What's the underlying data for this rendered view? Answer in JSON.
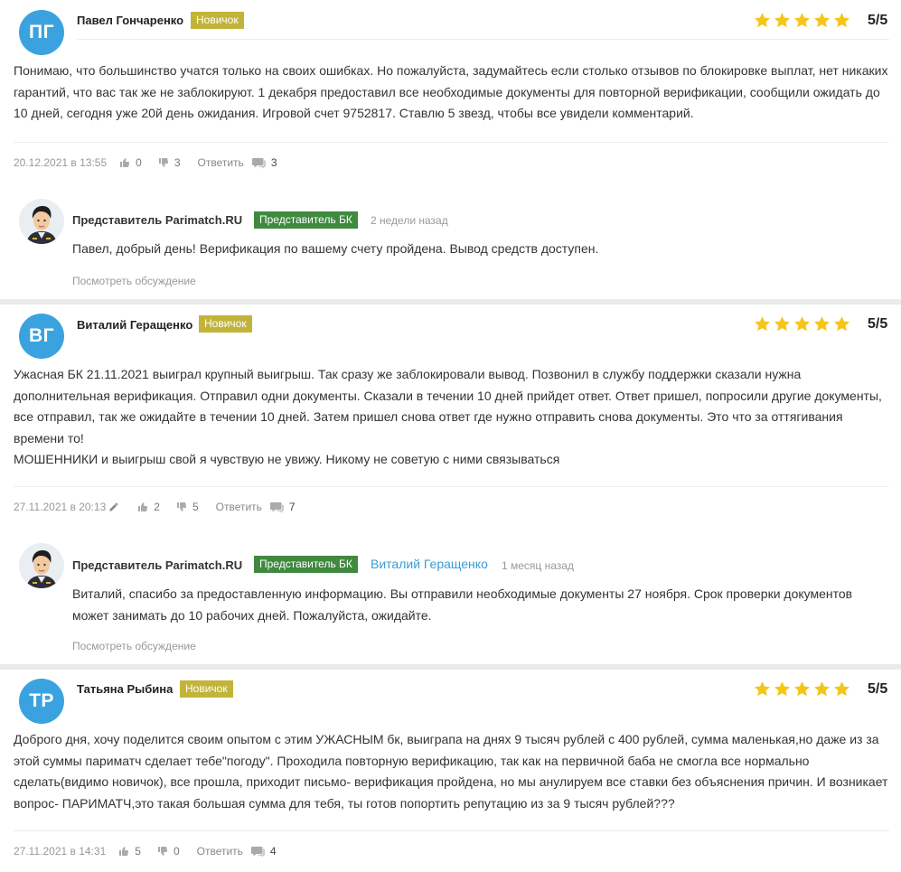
{
  "colors": {
    "avatar": "#3aa3df",
    "newbie_badge": "#c2b43b",
    "rep_badge": "#3f8a3f",
    "star": "#f5c518",
    "link": "#3a9bd6"
  },
  "reviews": [
    {
      "initials": "ПГ",
      "author": "Павел Гончаренко",
      "badge": "Новичок",
      "rating_text": "5/5",
      "rating": 5,
      "text": "Понимаю, что большинство учатся только на своих ошибках. Но пожалуйста, задумайтесь если столько отзывов по блокировке выплат, нет никаких гарантий, что вас так же не заблокируют. 1 декабря предоставил все необходимые документы для повторной верификации, сообщили ожидать до 10 дней, сегодня уже 20й день ожидания. Игровой счет 9752817. Ставлю 5 звезд, чтобы все увидели комментарий.",
      "date": "20.12.2021 в 13:55",
      "likes": "0",
      "dislikes": "3",
      "reply_label": "Ответить",
      "comments": "3",
      "response": {
        "name": "Представитель Parimatch.RU",
        "badge": "Представитель БК",
        "to": "",
        "time": "2 недели назад",
        "text": "Павел, добрый день! Верификация по вашему счету пройдена. Вывод средств доступен.",
        "link": "Посмотреть обсуждение"
      }
    },
    {
      "initials": "ВГ",
      "author": "Виталий Геращенко",
      "badge": "Новичок",
      "rating_text": "5/5",
      "rating": 5,
      "text": "Ужасная БК 21.11.2021 выиграл крупный выигрыш. Так сразу же заблокировали вывод. Позвонил в службу поддержки сказали нужна дополнительная верификация. Отправил одни документы. Сказали в течении 10 дней прийдет ответ. Ответ пришел, попросили другие документы, все отправил, так же ожидайте в течении 10 дней. Затем пришел снова ответ где нужно отправить снова документы. Это что за оттягивания времени то!\nМОШЕННИКИ и выигрыш свой я чувствую не увижу. Никому не советую с ними связываться",
      "date": "27.11.2021 в 20:13",
      "likes": "2",
      "dislikes": "5",
      "reply_label": "Ответить",
      "comments": "7",
      "response": {
        "name": "Представитель Parimatch.RU",
        "badge": "Представитель БК",
        "to": "Виталий Геращенко",
        "time": "1 месяц назад",
        "text": "Виталий, спасибо за предоставленную информацию. Вы отправили необходимые документы 27 ноября. Срок проверки документов может занимать до 10 рабочих дней. Пожалуйста, ожидайте.",
        "link": "Посмотреть обсуждение"
      }
    },
    {
      "initials": "ТР",
      "author": "Татьяна Рыбина",
      "badge": "Новичок",
      "rating_text": "5/5",
      "rating": 5,
      "text": "Доброго дня, хочу поделится своим опытом с этим УЖАСНЫМ бк, выиграпа на днях 9 тысяч рублей с 400 рублей, сумма маленькая,но даже из за этой суммы париматч сделает тебе\"погоду\". Проходила повторную верификацию, так как на первичной баба не смогла все нормально сделать(видимо новичок), все прошла, приходит письмо- верификация пройдена, но мы анулируем все ставки без объяснения причин. И возникает вопрос- ПАРИМАТЧ,это такая большая сумма для тебя, ты готов попортить репутацию из за 9 тысяч рублей???",
      "date": "27.11.2021 в 14:31",
      "likes": "5",
      "dislikes": "0",
      "reply_label": "Ответить",
      "comments": "4"
    }
  ]
}
